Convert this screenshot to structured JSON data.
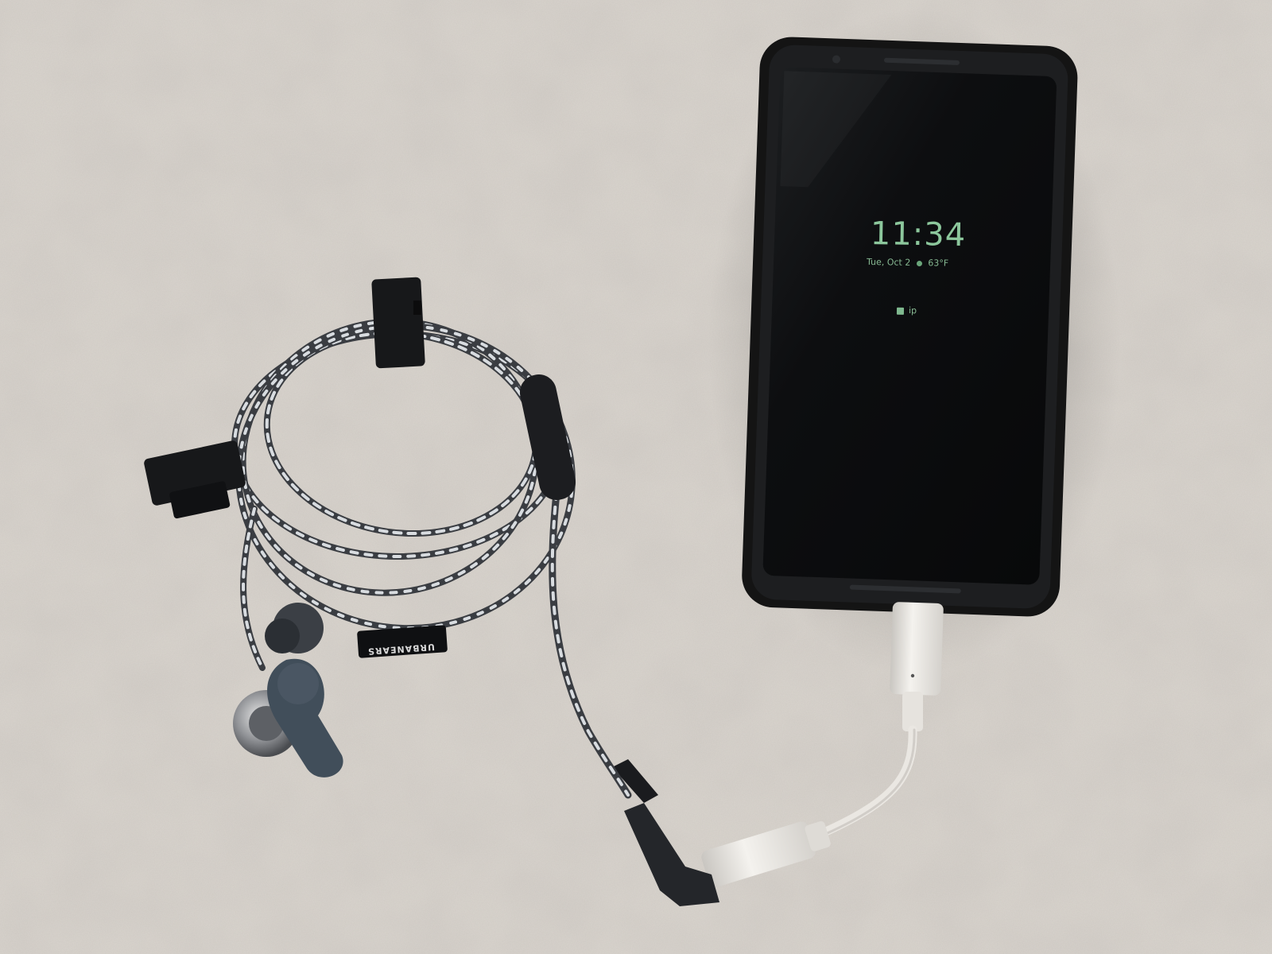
{
  "phone": {
    "clock": "11:34",
    "date": "Tue, Oct 2",
    "temperature": "63°F",
    "notification_label": "ip"
  },
  "earphones": {
    "brand_tag": "URBANEARS"
  },
  "colors": {
    "towel": "#cfcac4",
    "phone_body": "#141414",
    "screen": "#0c0d0e",
    "screen_text": "#8cc79c",
    "cable_dark": "#3a3d42",
    "cable_light": "#d8dce0",
    "adapter": "#eceae6"
  }
}
